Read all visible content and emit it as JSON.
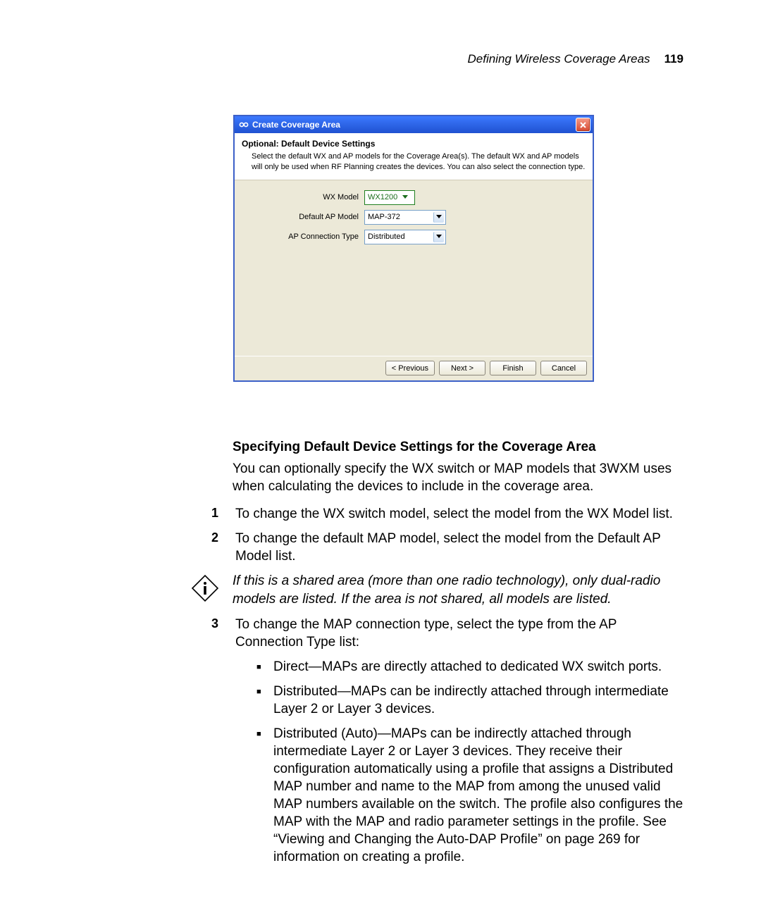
{
  "header": {
    "title": "Defining Wireless Coverage Areas",
    "page_number": "119"
  },
  "dialog": {
    "title": "Create Coverage Area",
    "heading": "Optional: Default Device Settings",
    "description": "Select the default WX and AP models for the Coverage Area(s). The default WX and AP models will only be used when RF Planning creates the devices. You can also select the connection type.",
    "fields": {
      "wx_model": {
        "label": "WX Model",
        "value": "WX1200"
      },
      "ap_model": {
        "label": "Default AP Model",
        "value": "MAP-372"
      },
      "conn_type": {
        "label": "AP Connection Type",
        "value": "Distributed"
      }
    },
    "buttons": {
      "previous": "< Previous",
      "next": "Next >",
      "finish": "Finish",
      "cancel": "Cancel"
    }
  },
  "doc": {
    "section_heading": "Specifying Default Device Settings for the Coverage Area",
    "lead": "You can optionally specify the WX switch or MAP models that 3WXM uses when calculating the devices to include in the coverage area.",
    "step1_num": "1",
    "step1": "To change the WX switch model, select the model from the WX Model list.",
    "step2_num": "2",
    "step2": "To change the default MAP model, select the model from the Default AP Model list.",
    "note": "If this is a shared area (more than one radio technology), only dual-radio models are listed. If the area is not shared, all models are listed.",
    "step3_num": "3",
    "step3": "To change the MAP connection type, select the type from the AP Connection Type list:",
    "bullets": {
      "b1": "Direct—MAPs are directly attached to dedicated WX switch ports.",
      "b2": "Distributed—MAPs can be indirectly attached through intermediate Layer 2 or Layer 3 devices.",
      "b3": "Distributed (Auto)—MAPs can be indirectly attached through intermediate Layer 2 or Layer 3 devices. They receive their configuration automatically using a profile that assigns a Distributed MAP number and name to the MAP from among the unused valid MAP numbers available on the switch. The profile also configures the MAP with the MAP and radio parameter settings in the profile. See “Viewing and Changing the Auto-DAP Profile” on page 269 for information on creating a profile."
    }
  }
}
